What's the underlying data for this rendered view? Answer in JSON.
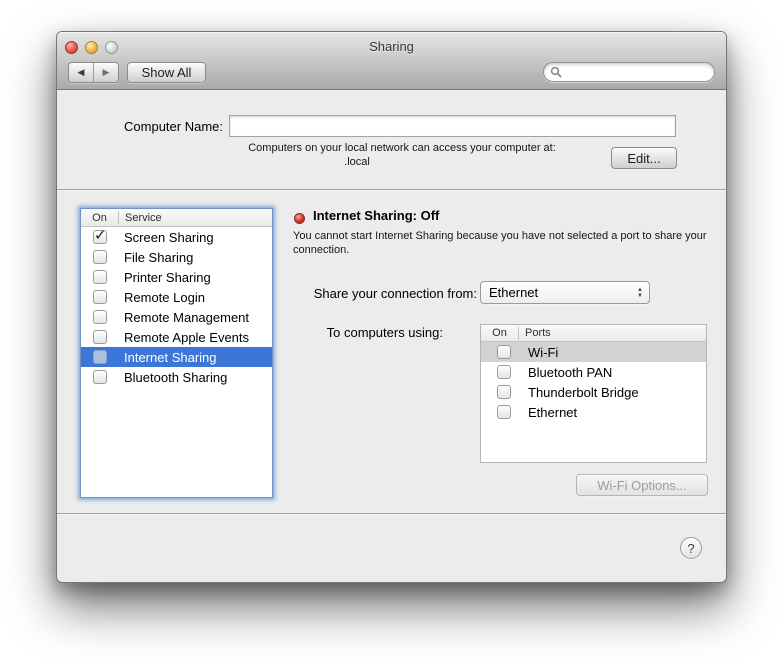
{
  "colors": {
    "selection_blue": "#3c77d8",
    "selection_inactive_gray": "#d2d2d2",
    "focus_ring_blue": "#82abdd",
    "status_off_red": "#cf3a2f"
  },
  "icons": {
    "back": "◀",
    "forward": "▶",
    "checkmark": "✓",
    "stepper_up": "▲",
    "stepper_down": "▼",
    "help": "?"
  },
  "window": {
    "title": "Sharing"
  },
  "toolbar": {
    "show_all_label": "Show All",
    "search_value": ""
  },
  "computer_name": {
    "label": "Computer Name:",
    "value": "",
    "helper_line1": "Computers on your local network can access your computer at:",
    "helper_line2": ".local",
    "edit_button_label": "Edit..."
  },
  "services": {
    "columns": {
      "on": "On",
      "service": "Service"
    },
    "items": [
      {
        "label": "Screen Sharing",
        "checked": true,
        "selected": false
      },
      {
        "label": "File Sharing",
        "checked": false,
        "selected": false
      },
      {
        "label": "Printer Sharing",
        "checked": false,
        "selected": false
      },
      {
        "label": "Remote Login",
        "checked": false,
        "selected": false
      },
      {
        "label": "Remote Management",
        "checked": false,
        "selected": false
      },
      {
        "label": "Remote Apple Events",
        "checked": false,
        "selected": false
      },
      {
        "label": "Internet Sharing",
        "checked": false,
        "selected": true
      },
      {
        "label": "Bluetooth Sharing",
        "checked": false,
        "selected": false
      }
    ]
  },
  "detail": {
    "status_title": "Internet Sharing: Off",
    "description": "You cannot start Internet Sharing because you have not selected a port to share your connection.",
    "share_from_label": "Share your connection from:",
    "share_from_value": "Ethernet",
    "to_computers_label": "To computers using:",
    "ports_columns": {
      "on": "On",
      "ports": "Ports"
    },
    "ports": [
      {
        "label": "Wi-Fi",
        "checked": false,
        "selected": true
      },
      {
        "label": "Bluetooth PAN",
        "checked": false,
        "selected": false
      },
      {
        "label": "Thunderbolt Bridge",
        "checked": false,
        "selected": false
      },
      {
        "label": "Ethernet",
        "checked": false,
        "selected": false
      }
    ],
    "options_button_label": "Wi-Fi Options...",
    "options_button_enabled": false
  }
}
